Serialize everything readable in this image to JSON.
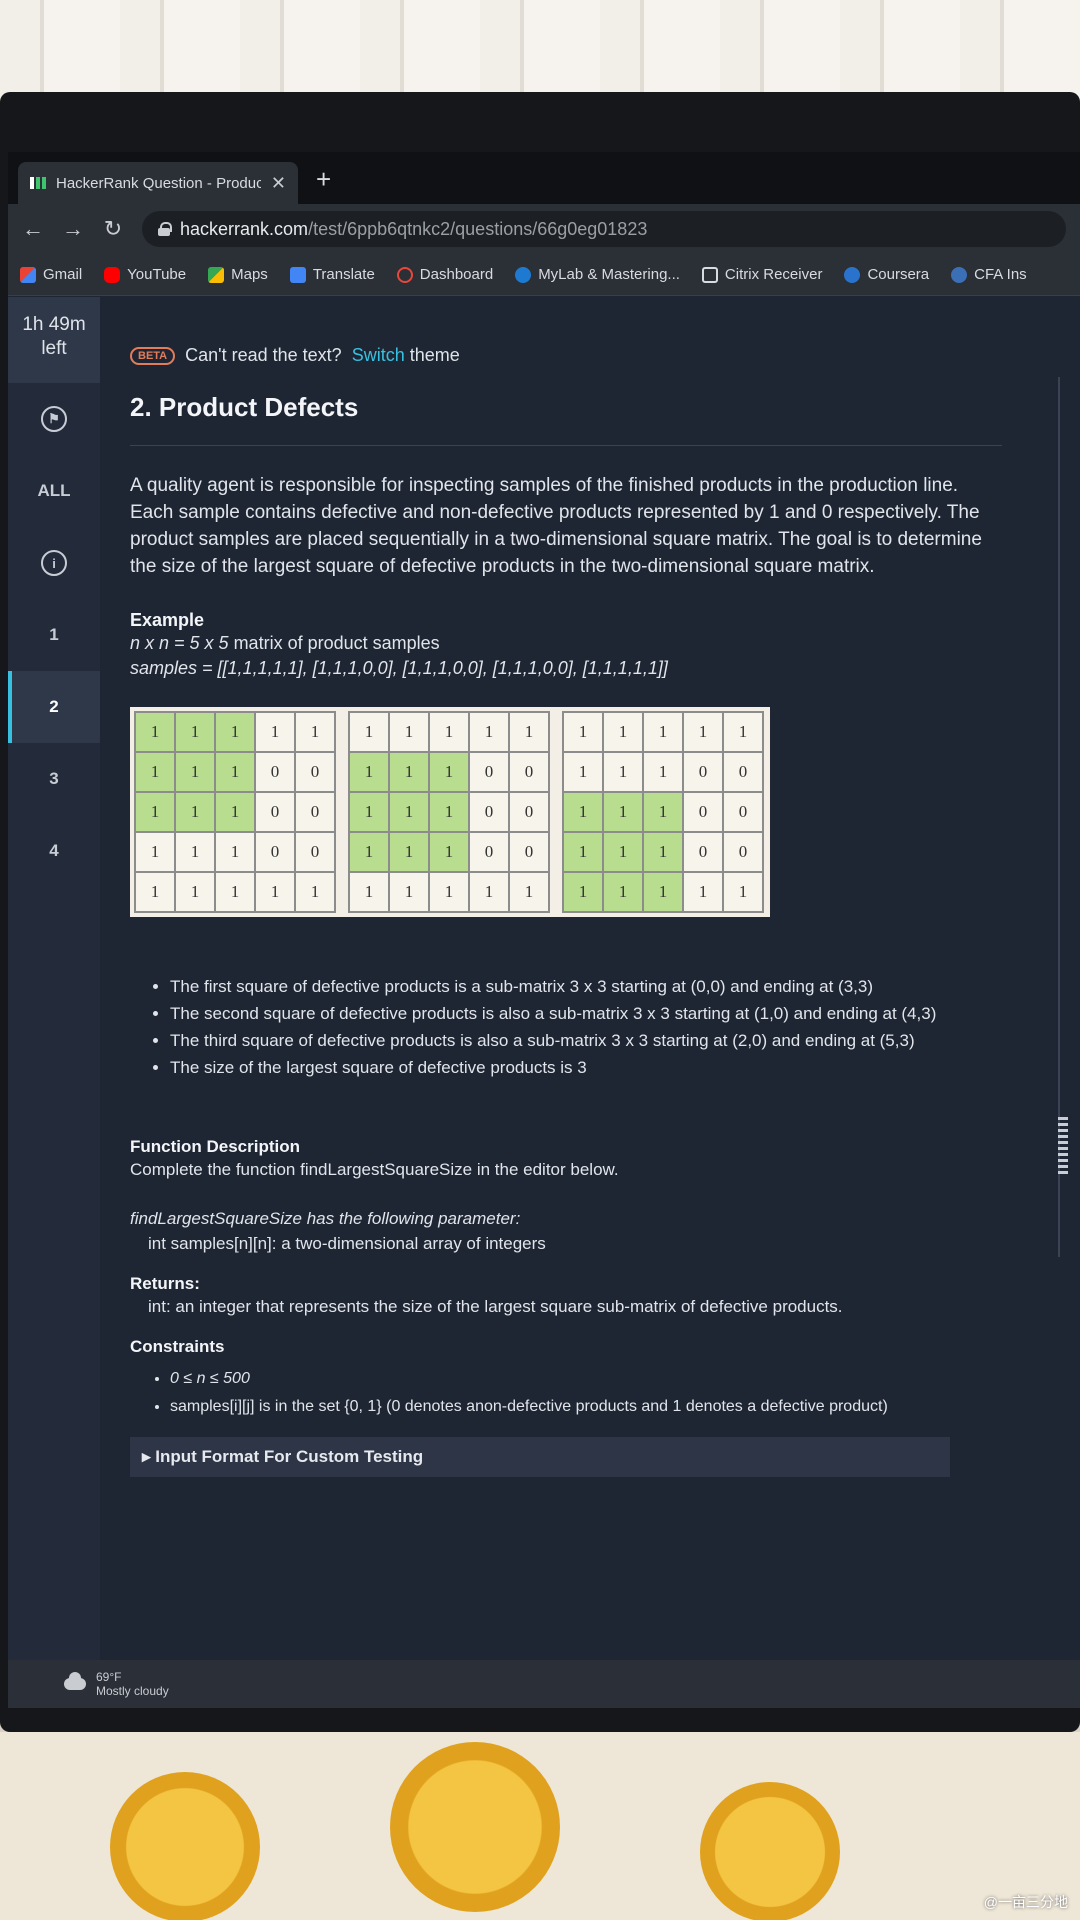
{
  "browser": {
    "tab_title": "HackerRank Question - Product I",
    "tab_close": "✕",
    "new_tab": "+",
    "url_host": "hackerrank.com",
    "url_path": "/test/6ppb6qtnkc2/questions/66g0eg01823",
    "bookmarks": [
      "Gmail",
      "YouTube",
      "Maps",
      "Translate",
      "Dashboard",
      "MyLab & Mastering...",
      "Citrix Receiver",
      "Coursera",
      "CFA Ins"
    ]
  },
  "sidebar": {
    "timer_line1": "1h 49m",
    "timer_line2": "left",
    "items": [
      {
        "label": "",
        "icon": "flag-icon"
      },
      {
        "label": "ALL"
      },
      {
        "label": "i",
        "icon": "info-icon"
      },
      {
        "label": "1"
      },
      {
        "label": "2",
        "active": true
      },
      {
        "label": "3"
      },
      {
        "label": "4"
      }
    ]
  },
  "banner": {
    "badge": "BETA",
    "text_before": "Can't read the text?",
    "link": "Switch",
    "text_after": "theme"
  },
  "question": {
    "title": "2. Product Defects",
    "description": "A quality agent is responsible for inspecting samples of the finished products in the production line. Each sample contains defective and non-defective products represented by 1 and 0 respectively.  The product samples are placed sequentially in a two-dimensional square matrix. The goal is to determine the size of the largest square of defective products in the two-dimensional square matrix.",
    "example_heading": "Example",
    "example_line1_italic": "n x n = 5 x 5",
    "example_line1_rest": " matrix of product samples",
    "example_line2": "samples = [[1,1,1,1,1], [1,1,1,0,0], [1,1,1,0,0], [1,1,1,0,0], [1,1,1,1,1]]",
    "matrix": [
      [
        1,
        1,
        1,
        1,
        1
      ],
      [
        1,
        1,
        1,
        0,
        0
      ],
      [
        1,
        1,
        1,
        0,
        0
      ],
      [
        1,
        1,
        1,
        0,
        0
      ],
      [
        1,
        1,
        1,
        1,
        1
      ]
    ],
    "highlight_start_rows": [
      0,
      1,
      2
    ],
    "bullets": [
      "The first square of defective products is a sub-matrix 3 x 3 starting at (0,0) and ending at (3,3)",
      "The second square of defective products is also a sub-matrix 3 x 3 starting at (1,0) and ending at (4,3)",
      "The third square of defective products is also a sub-matrix 3 x 3 starting at (2,0) and ending at (5,3)",
      "The size of the largest square of defective products is 3"
    ],
    "function_heading": "Function Description",
    "function_text": "Complete the function findLargestSquareSize in the editor below.",
    "param_intro": "findLargestSquareSize has the following parameter:",
    "param_line": "int samples[n][n]:  a two-dimensional array of integers",
    "returns_heading": "Returns:",
    "returns_text": "int: an integer that represents the size of the largest square sub-matrix of defective products.",
    "constraints_heading": "Constraints",
    "constraints": [
      "0 ≤ n ≤ 500",
      "samples[i][j] is in the set {0, 1} (0 denotes anon-defective products and 1 denotes a defective product)"
    ],
    "input_format": "▸ Input Format For Custom Testing"
  },
  "taskbar": {
    "temp": "69°F",
    "weather": "Mostly cloudy"
  },
  "watermark": "@一亩三分地"
}
